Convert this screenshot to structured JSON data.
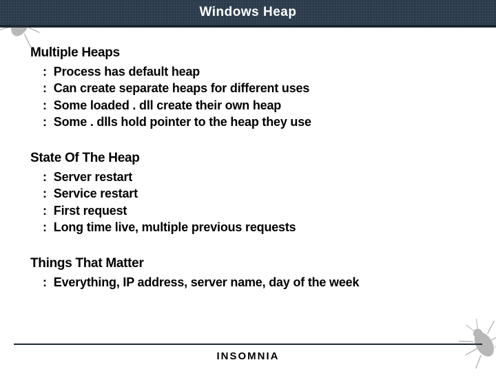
{
  "title": "Windows Heap",
  "sections": [
    {
      "heading": "Multiple Heaps",
      "items": [
        "Process has default heap",
        "Can create separate heaps for different uses",
        "Some loaded . dll create their own heap",
        "Some . dlls hold pointer to the heap they use"
      ]
    },
    {
      "heading": "State Of The Heap",
      "items": [
        "Server restart",
        "Service restart",
        "First request",
        "Long time live, multiple previous requests"
      ]
    },
    {
      "heading": "Things That Matter",
      "items": [
        "Everything, IP address, server name, day of the week"
      ]
    }
  ],
  "brand": "INSOMNIA"
}
